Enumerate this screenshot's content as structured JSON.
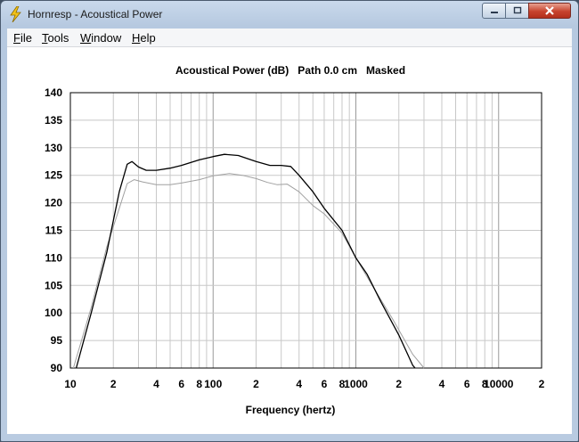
{
  "window": {
    "title": "Hornresp - Acoustical Power",
    "app_icon": "lightning-bolt-icon"
  },
  "menu": {
    "items": [
      {
        "accel": "F",
        "rest": "ile"
      },
      {
        "accel": "T",
        "rest": "ools"
      },
      {
        "accel": "W",
        "rest": "indow"
      },
      {
        "accel": "H",
        "rest": "elp"
      }
    ]
  },
  "colors": {
    "titlebar": "#b6c9e0",
    "close_button": "#c7432e",
    "plot_primary": "#000000",
    "plot_secondary": "#a0a0a0",
    "grid": "#c8c8c8"
  },
  "chart_data": {
    "type": "line",
    "title": "Acoustical Power (dB)   Path 0.0 cm   Masked",
    "xlabel": "Frequency (hertz)",
    "ylabel": "",
    "x_scale": "log",
    "xlim": [
      10,
      20000
    ],
    "ylim": [
      90,
      140
    ],
    "y_ticks": [
      90,
      95,
      100,
      105,
      110,
      115,
      120,
      125,
      130,
      135,
      140
    ],
    "x_ticks": [
      {
        "value": 10,
        "label": "10"
      },
      {
        "value": 20,
        "label": "2"
      },
      {
        "value": 40,
        "label": "4"
      },
      {
        "value": 60,
        "label": "6"
      },
      {
        "value": 80,
        "label": "8"
      },
      {
        "value": 100,
        "label": "100"
      },
      {
        "value": 200,
        "label": "2"
      },
      {
        "value": 400,
        "label": "4"
      },
      {
        "value": 600,
        "label": "6"
      },
      {
        "value": 800,
        "label": "8"
      },
      {
        "value": 1000,
        "label": "1000"
      },
      {
        "value": 2000,
        "label": "2"
      },
      {
        "value": 4000,
        "label": "4"
      },
      {
        "value": 6000,
        "label": "6"
      },
      {
        "value": 8000,
        "label": "8"
      },
      {
        "value": 10000,
        "label": "10000"
      },
      {
        "value": 20000,
        "label": "2"
      }
    ],
    "grid": true,
    "series": [
      {
        "color": "#000000",
        "points": [
          [
            11,
            90
          ],
          [
            14,
            100
          ],
          [
            18,
            111
          ],
          [
            22,
            122
          ],
          [
            25,
            127
          ],
          [
            27,
            127.5
          ],
          [
            30,
            126.5
          ],
          [
            34,
            125.9
          ],
          [
            40,
            125.9
          ],
          [
            50,
            126.3
          ],
          [
            60,
            126.8
          ],
          [
            80,
            127.8
          ],
          [
            100,
            128.4
          ],
          [
            120,
            128.8
          ],
          [
            150,
            128.6
          ],
          [
            200,
            127.5
          ],
          [
            250,
            126.8
          ],
          [
            300,
            126.8
          ],
          [
            350,
            126.6
          ],
          [
            400,
            125
          ],
          [
            500,
            122
          ],
          [
            600,
            119
          ],
          [
            800,
            115
          ],
          [
            1000,
            110
          ],
          [
            1200,
            107
          ],
          [
            1500,
            102
          ],
          [
            2000,
            96
          ],
          [
            2500,
            90.5
          ],
          [
            2600,
            90
          ]
        ]
      },
      {
        "color": "#a0a0a0",
        "points": [
          [
            10.5,
            90
          ],
          [
            14,
            101
          ],
          [
            18,
            112
          ],
          [
            22,
            119
          ],
          [
            25,
            123.5
          ],
          [
            28,
            124.2
          ],
          [
            32,
            123.8
          ],
          [
            40,
            123.3
          ],
          [
            50,
            123.3
          ],
          [
            60,
            123.6
          ],
          [
            80,
            124.2
          ],
          [
            100,
            124.9
          ],
          [
            130,
            125.3
          ],
          [
            160,
            125
          ],
          [
            200,
            124.4
          ],
          [
            240,
            123.7
          ],
          [
            280,
            123.3
          ],
          [
            330,
            123.4
          ],
          [
            400,
            122
          ],
          [
            500,
            119.5
          ],
          [
            600,
            118
          ],
          [
            800,
            114.5
          ],
          [
            1000,
            110
          ],
          [
            1300,
            105
          ],
          [
            1800,
            99
          ],
          [
            2500,
            92.5
          ],
          [
            3000,
            90
          ]
        ]
      }
    ]
  }
}
